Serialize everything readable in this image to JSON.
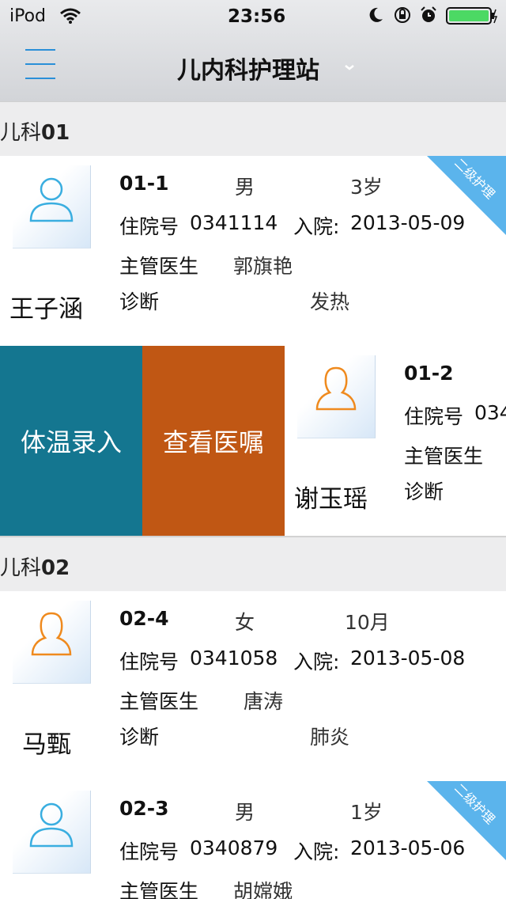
{
  "status": {
    "carrier": "iPod",
    "time": "23:56"
  },
  "nav": {
    "title": "儿内科护理站"
  },
  "sections": [
    {
      "label_prefix": "儿科",
      "label_num": "01",
      "rows": [
        {
          "bed": "01-1",
          "sex": "男",
          "age": "3岁",
          "admission_no_label": "住院号",
          "admission_no": "0341114",
          "admit_label": "入院:",
          "admit_date": "2013-05-09",
          "doctor_label": "主管医生",
          "doctor": "郭旗艳",
          "diag_label": "诊断",
          "diag": "发热",
          "name": "王子涵",
          "gender": "male",
          "ribbon": "二级护理"
        },
        {
          "bed": "01-2",
          "admission_no_label": "住院号",
          "admission_no_partial": "034",
          "doctor_label": "主管医生",
          "diag_label": "诊断",
          "name": "谢玉瑶",
          "gender": "female",
          "actions": [
            "体温录入",
            "查看医嘱"
          ]
        }
      ]
    },
    {
      "label_prefix": "儿科",
      "label_num": "02",
      "rows": [
        {
          "bed": "02-4",
          "sex": "女",
          "age": "10月",
          "admission_no_label": "住院号",
          "admission_no": "0341058",
          "admit_label": "入院:",
          "admit_date": "2013-05-08",
          "doctor_label": "主管医生",
          "doctor": "唐涛",
          "diag_label": "诊断",
          "diag": "肺炎",
          "name": "马甄",
          "gender": "female"
        },
        {
          "bed": "02-3",
          "sex": "男",
          "age": "1岁",
          "admission_no_label": "住院号",
          "admission_no": "0340879",
          "admit_label": "入院:",
          "admit_date": "2013-05-06",
          "doctor_label": "主管医生",
          "doctor": "胡嫦娥",
          "gender": "male",
          "ribbon": "二级护理"
        }
      ]
    }
  ],
  "colors": {
    "accent": "#2a8fd8",
    "male_icon": "#3aaee0",
    "female_icon": "#ef8a1e",
    "action_temp": "#147690",
    "action_orders": "#c05714",
    "ribbon": "#5bb4ec"
  },
  "icons": [
    "wifi-icon",
    "moon-icon",
    "rotation-lock-icon",
    "alarm-icon",
    "battery-icon",
    "menu-icon",
    "chevron-down-icon",
    "person-icon"
  ]
}
